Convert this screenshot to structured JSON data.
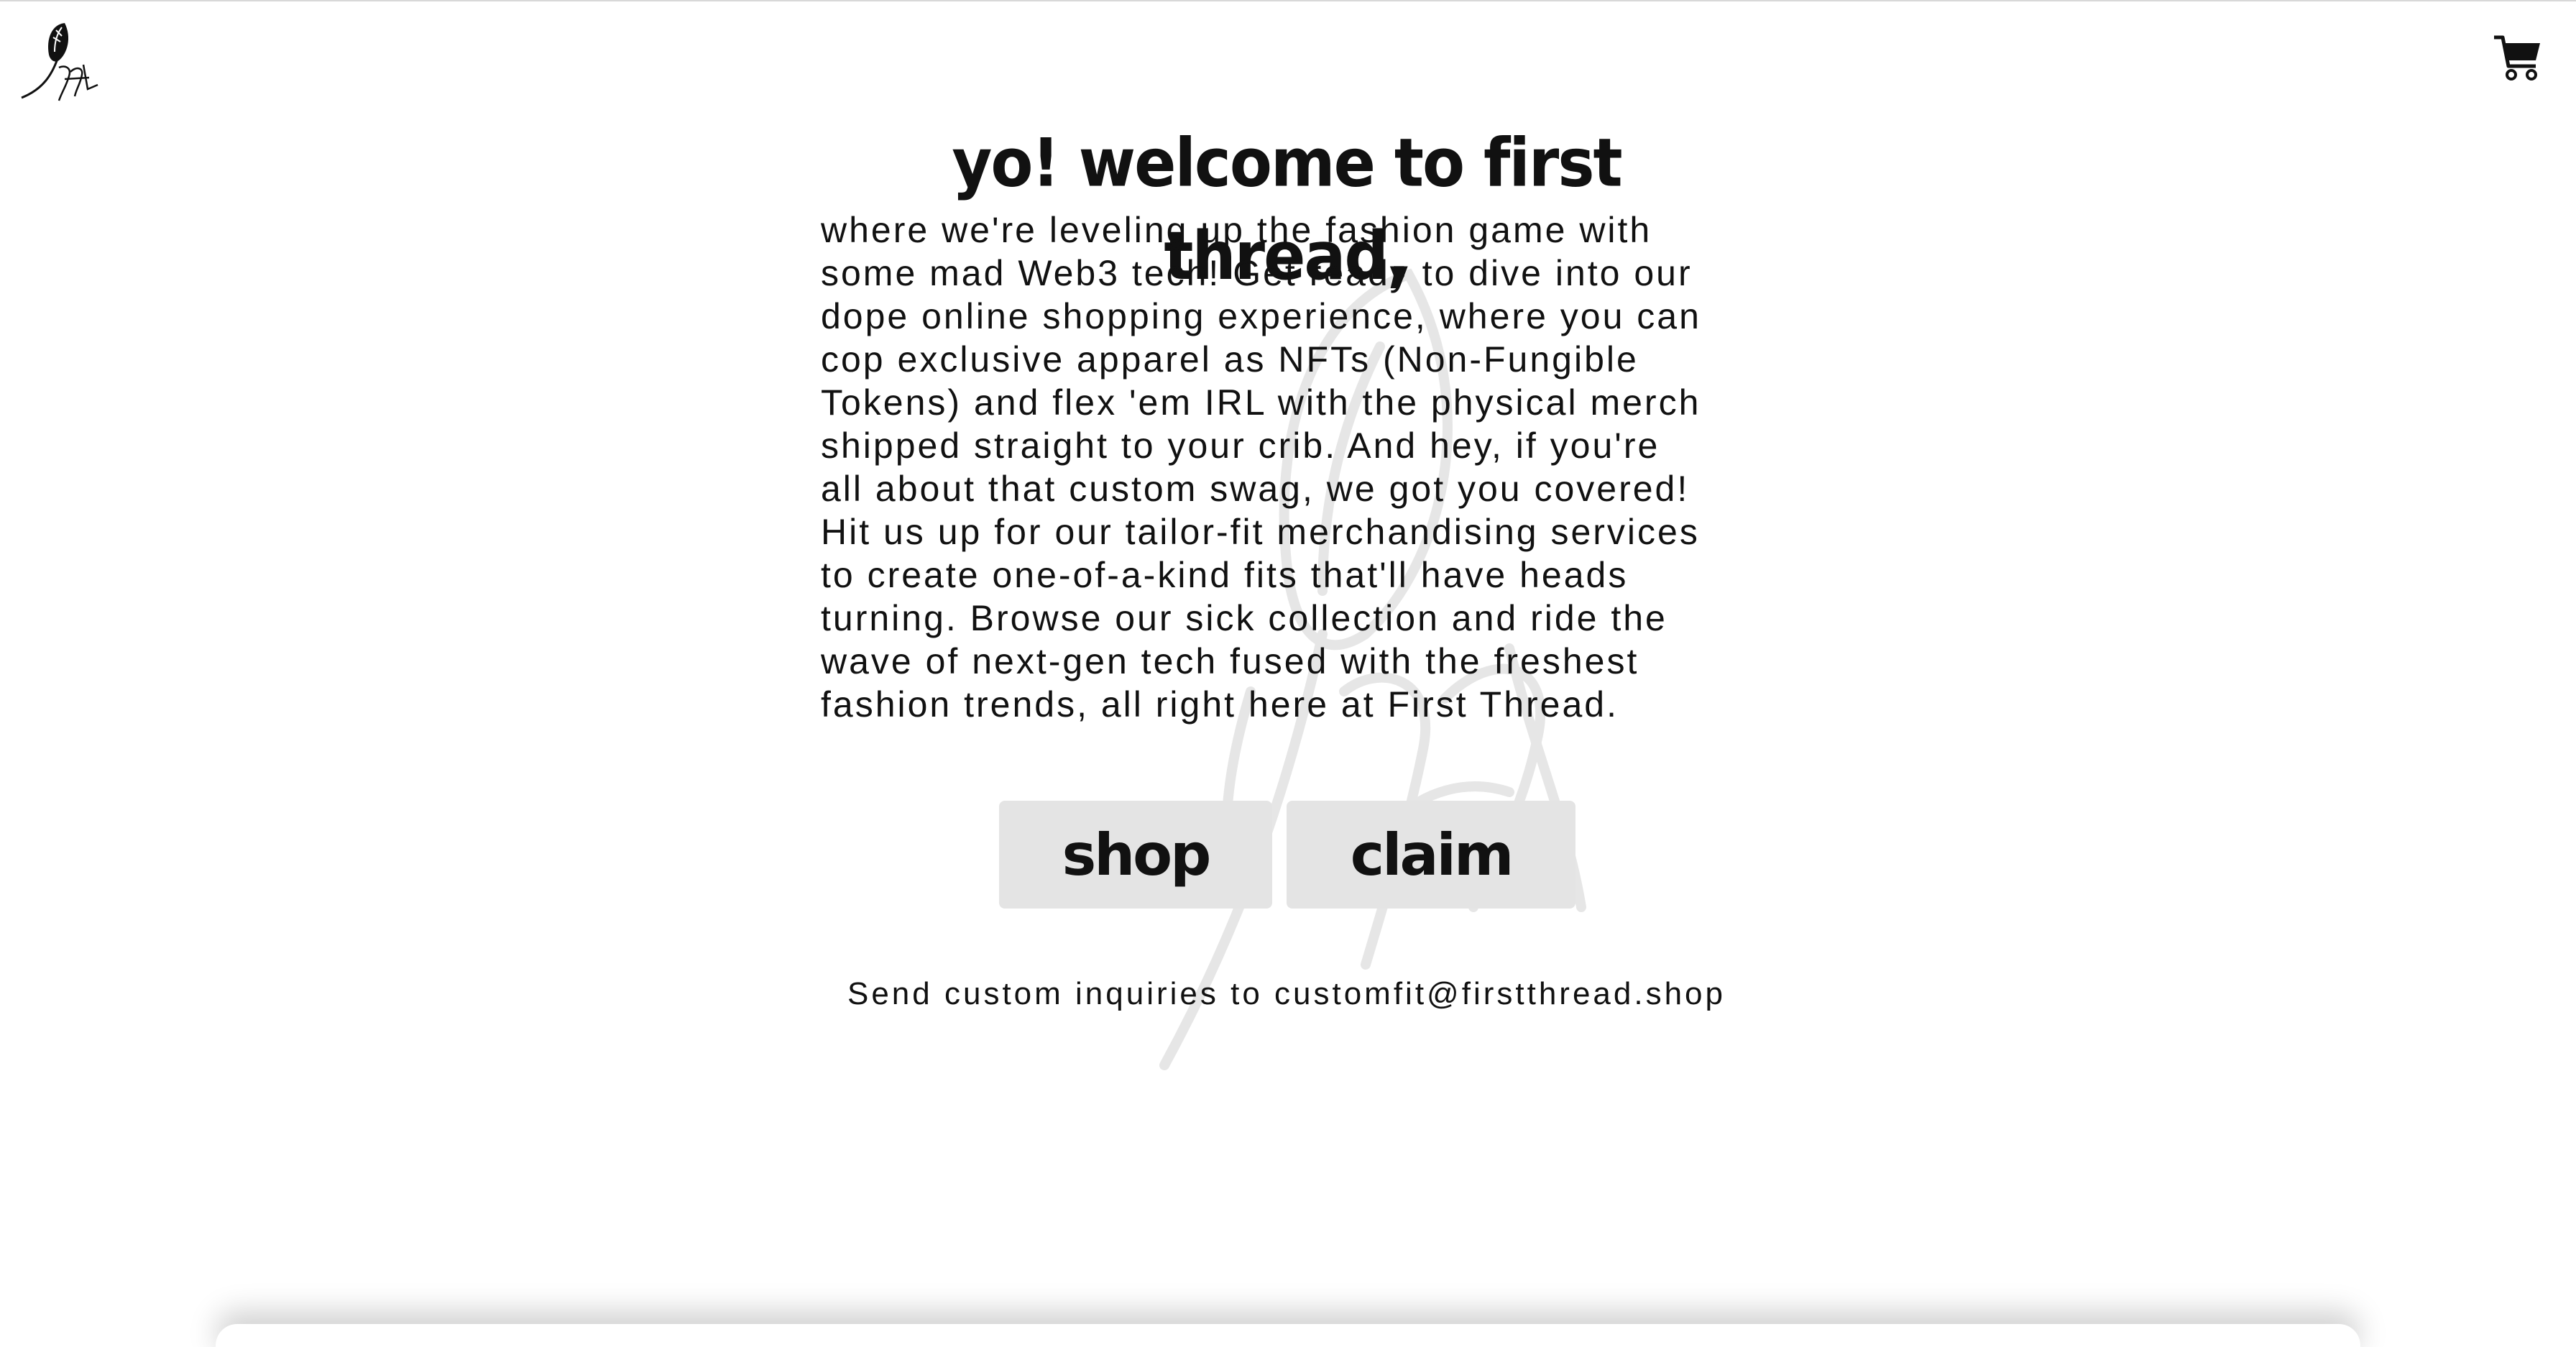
{
  "header": {
    "logo_icon": "feather-fft-logo-icon",
    "cart_icon": "shopping-cart-icon"
  },
  "hero": {
    "headline": "yo! welcome to first thread,",
    "lines": [
      "where we're leveling up the fashion game with",
      "some mad Web3 tech! Get ready to dive into our",
      "dope online shopping experience, where you can",
      "cop exclusive apparel as NFTs (Non-Fungible",
      "Tokens) and flex 'em IRL with the physical merch",
      "shipped straight to your crib. And hey, if you're",
      "all about that custom swag, we got you covered!",
      "Hit us up for our tailor-fit merchandising services",
      "to create one-of-a-kind fits that'll have heads",
      "turning. Browse our sick collection and ride the",
      "wave of next-gen tech fused with the freshest",
      "fashion trends, all right here at First Thread."
    ],
    "watermark_icon": "feather-watermark-icon"
  },
  "actions": {
    "shop_label": "shop",
    "claim_label": "claim"
  },
  "footer": {
    "inquiry_text": "Send custom inquiries to customfit@firstthread.shop"
  },
  "colors": {
    "text": "#111111",
    "button_bg": "#e4e4e4",
    "background": "#ffffff"
  }
}
